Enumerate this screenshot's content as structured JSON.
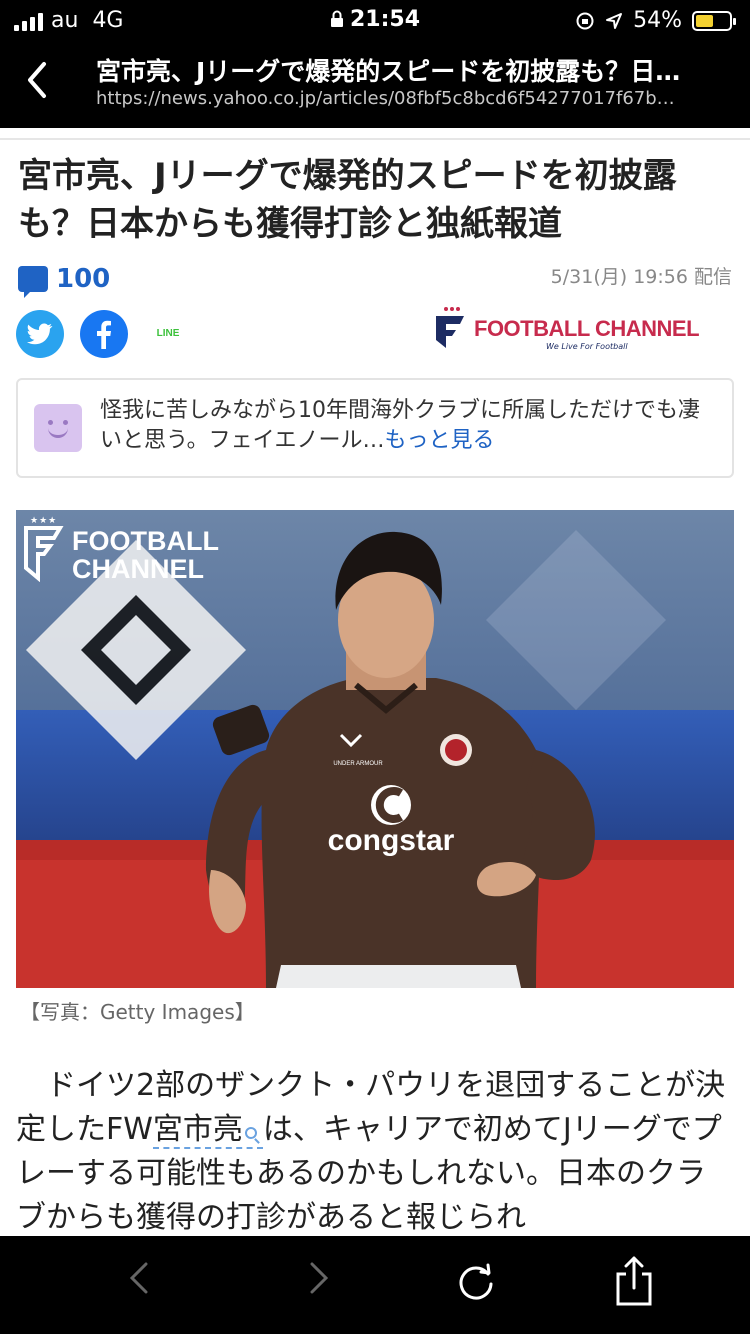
{
  "status_bar": {
    "carrier": "au",
    "network": "4G",
    "time": "21:54",
    "battery_percent": "54%",
    "battery_level": 0.54,
    "battery_color": "#f3d131"
  },
  "nav": {
    "back_icon": "chevron-left-icon",
    "title": "宮市亮、Jリーグで爆発的スピードを初披露も？日…",
    "url": "https://news.yahoo.co.jp/articles/08fbf5c8bcd6f54277017f67b…"
  },
  "article": {
    "headline": "宮市亮、Jリーグで爆発的スピードを初披露も？日本からも獲得打診と独紙報道",
    "comment_count": "100",
    "date": "5/31(月) 19:56 配信",
    "share": {
      "twitter": "twitter-icon",
      "facebook": "facebook-icon",
      "line": "LINE"
    },
    "publisher": {
      "name": "FOOTBALL CHANNEL",
      "tagline": "We Live For Football",
      "color": "#c72b4d",
      "navy": "#1d2c63"
    },
    "top_comment": {
      "text": "怪我に苦しみながら10年間海外クラブに所属しただけでも凄いと思う。フェイエノール…",
      "more_label": "もっと見る"
    },
    "photo": {
      "logo_line1": "FOOTBALL",
      "logo_line2": "CHANNEL",
      "sponsor": "congstar",
      "caption": "【写真：Getty Images】"
    },
    "body": {
      "before_link": "　ドイツ2部のザンクト・パウリを退団することが決定したFW",
      "link": "宮市亮",
      "after_link": "は、キャリアで初めてJリーグでプレーする可能性もあるのかもしれない。日本のクラブからも獲得の打診があると報じられ"
    }
  },
  "toolbar": {
    "back": "‹",
    "forward": "›",
    "reload_icon": "reload-icon",
    "share_icon": "share-icon"
  }
}
